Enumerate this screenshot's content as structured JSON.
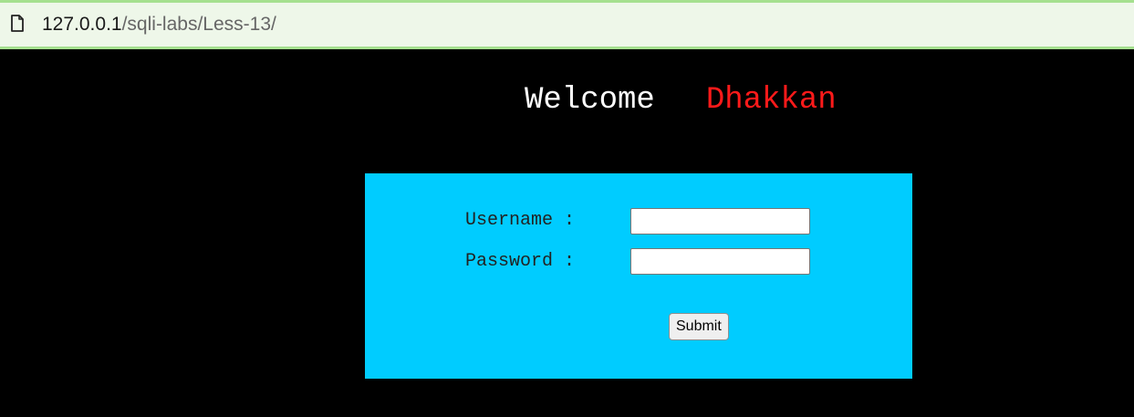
{
  "browser": {
    "url_host": "127.0.0.1",
    "url_path": "/sqli-labs/Less-13/",
    "page_icon": "document-icon"
  },
  "header": {
    "welcome": "Welcome",
    "name": "Dhakkan"
  },
  "login_form": {
    "username_label": "Username :",
    "username_value": "",
    "password_label": "Password :",
    "password_value": "",
    "submit_label": "Submit"
  },
  "colors": {
    "page_background": "#000000",
    "panel_background": "#00ccff",
    "name_color": "#ff1a1a",
    "welcome_color": "#ffffff",
    "address_bar_border": "#a5e08f"
  }
}
